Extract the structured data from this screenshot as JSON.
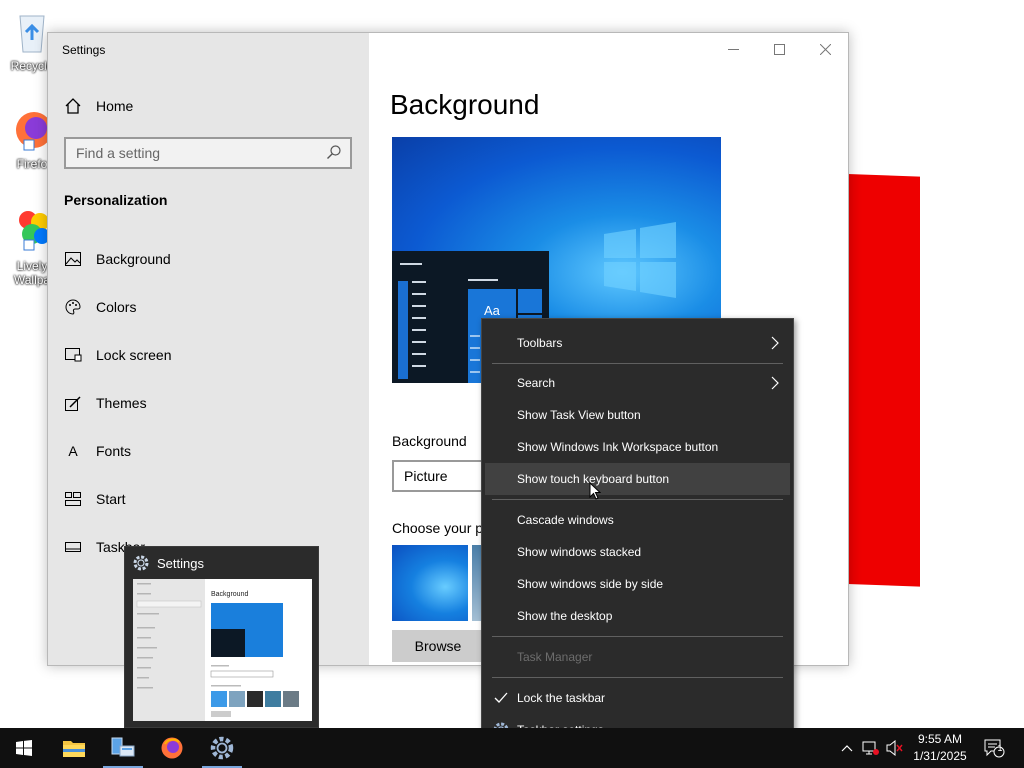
{
  "desktop": {
    "icons": [
      {
        "label": "Recycle"
      },
      {
        "label": "Firefo"
      },
      {
        "label": "Lively Wallpa"
      }
    ]
  },
  "settings": {
    "title": "Settings",
    "home_label": "Home",
    "search_placeholder": "Find a setting",
    "section_title": "Personalization",
    "nav": [
      {
        "label": "Background",
        "icon": "picture-icon"
      },
      {
        "label": "Colors",
        "icon": "palette-icon"
      },
      {
        "label": "Lock screen",
        "icon": "lock-screen-icon"
      },
      {
        "label": "Themes",
        "icon": "themes-icon"
      },
      {
        "label": "Fonts",
        "icon": "fonts-icon"
      },
      {
        "label": "Start",
        "icon": "start-icon"
      },
      {
        "label": "Taskbar",
        "icon": "taskbar-icon"
      }
    ],
    "main": {
      "title": "Background",
      "preview_text": "Aa",
      "background_label": "Background",
      "background_value": "Picture",
      "choose_label": "Choose your p",
      "browse_label": "Browse"
    }
  },
  "thumbnail": {
    "title": "Settings",
    "mini_title": "Background"
  },
  "context_menu": {
    "items": [
      {
        "label": "Toolbars",
        "submenu": true
      },
      {
        "label": "Search",
        "submenu": true
      },
      {
        "label": "Show Task View button"
      },
      {
        "label": "Show Windows Ink Workspace button"
      },
      {
        "label": "Show touch keyboard button",
        "hover": true
      },
      {
        "label": "Cascade windows"
      },
      {
        "label": "Show windows stacked"
      },
      {
        "label": "Show windows side by side"
      },
      {
        "label": "Show the desktop"
      },
      {
        "label": "Task Manager",
        "disabled": true
      },
      {
        "label": "Lock the taskbar",
        "checked": true
      },
      {
        "label": "Taskbar settings",
        "icon": "gear-icon"
      }
    ]
  },
  "taskbar": {
    "time": "9:55 AM",
    "date": "1/31/2025",
    "notification_count": "1"
  },
  "colors": {
    "taskbar": "#101010",
    "menu_bg": "#2b2b2b",
    "sidebar_bg": "#e6e6e6",
    "accent": "#0078d7",
    "red_shape": "#ee0000"
  }
}
